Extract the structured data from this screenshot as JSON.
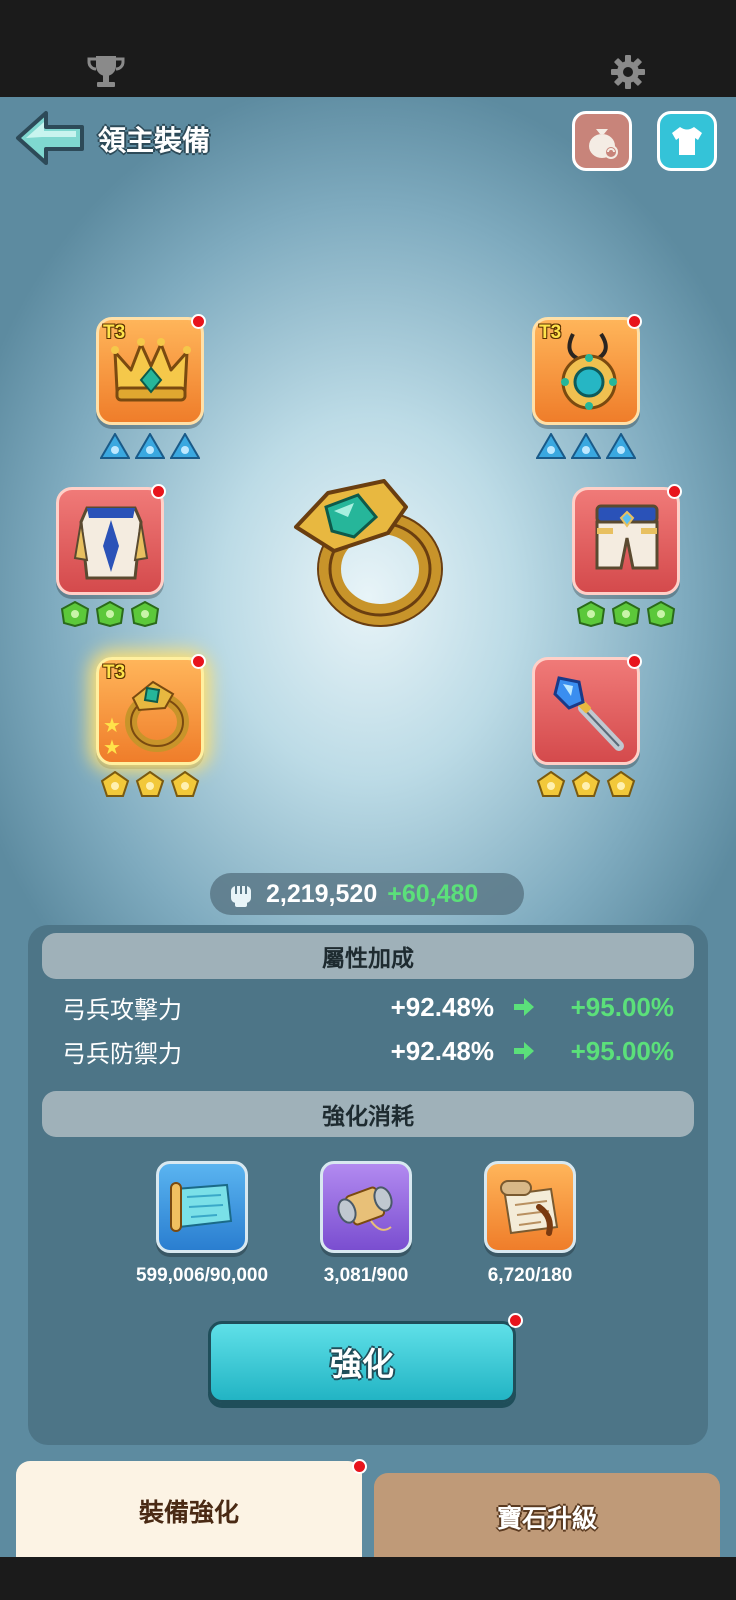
{
  "page": {
    "title": "領主裝備"
  },
  "power": {
    "value": "2,219,520",
    "delta": "+60,480"
  },
  "slots": [
    {
      "name": "crown",
      "tier": "T3"
    },
    {
      "name": "amulet",
      "tier": "T3"
    },
    {
      "name": "armor",
      "tier": ""
    },
    {
      "name": "pants",
      "tier": ""
    },
    {
      "name": "ring",
      "tier": "T3"
    },
    {
      "name": "scepter",
      "tier": ""
    }
  ],
  "attributes": {
    "header": "屬性加成",
    "rows": [
      {
        "name": "弓兵攻擊力",
        "current": "+92.48%",
        "next": "+95.00%"
      },
      {
        "name": "弓兵防禦力",
        "current": "+92.48%",
        "next": "+95.00%"
      }
    ]
  },
  "cost": {
    "header": "強化消耗",
    "items": [
      {
        "icon": "blueprint-scroll-icon",
        "qty": "599,006/90,000"
      },
      {
        "icon": "thread-spool-icon",
        "qty": "3,081/900"
      },
      {
        "icon": "design-map-icon",
        "qty": "6,720/180"
      }
    ]
  },
  "actions": {
    "enhance_label": "強化"
  },
  "tabs": {
    "active": "裝備強化",
    "inactive": "寶石升級"
  },
  "colors": {
    "accent": "#22b4c4",
    "gain": "#5be07a",
    "alert": "#e8141c"
  }
}
